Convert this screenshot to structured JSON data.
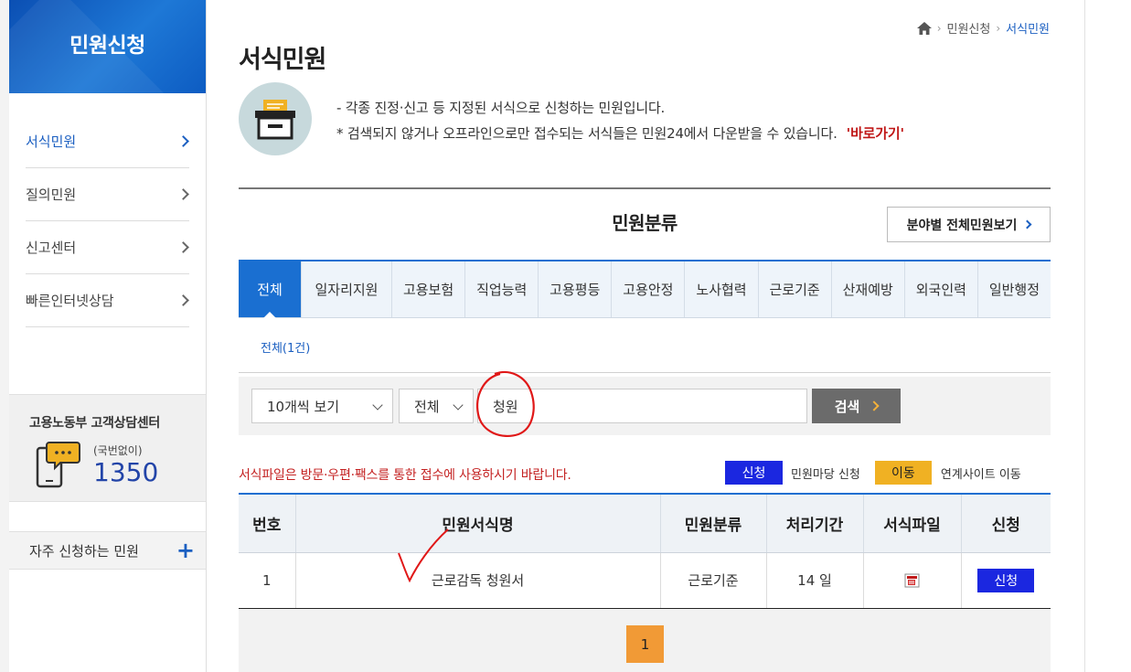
{
  "sidebar": {
    "title": "민원신청",
    "items": [
      {
        "label": "서식민원",
        "active": true
      },
      {
        "label": "질의민원",
        "active": false
      },
      {
        "label": "신고센터",
        "active": false
      },
      {
        "label": "빠른인터넷상담",
        "active": false
      }
    ],
    "cs_center": {
      "title": "고용노동부 고객상담센터",
      "sub": "(국번없이)",
      "number": "1350"
    },
    "favorite": {
      "label": "자주 신청하는 민원",
      "plus": "+"
    }
  },
  "breadcrumb": {
    "level1": "민원신청",
    "current": "서식민원"
  },
  "page_title": "서식민원",
  "intro": {
    "line1": "- 각종 진정·신고 등 지정된 서식으로 신청하는 민원입니다.",
    "line2": "* 검색되지 않거나 오프라인으로만 접수되는 서식들은 민원24에서 다운받을 수 있습니다.",
    "link": "'바로가기'"
  },
  "category": {
    "title": "민원분류",
    "all_view_button": "분야별 전체민원보기",
    "tabs": [
      "전체",
      "일자리지원",
      "고용보험",
      "직업능력",
      "고용평등",
      "고용안정",
      "노사협력",
      "근로기준",
      "산재예방",
      "외국인력",
      "일반행정"
    ],
    "count_label": "전체(1건)"
  },
  "search": {
    "page_size": "10개씩 보기",
    "scope": "전체",
    "query": "청원",
    "button": "검색"
  },
  "notice": "서식파일은 방문·우편·팩스를 통한 접수에 사용하시기 바랍니다.",
  "legend": {
    "apply_badge": "신청",
    "apply_desc": "민원마당 신청",
    "move_badge": "이동",
    "move_desc": "연계사이트 이동"
  },
  "table": {
    "headers": [
      "번호",
      "민원서식명",
      "민원분류",
      "처리기간",
      "서식파일",
      "신청"
    ],
    "rows": [
      {
        "no": "1",
        "name": "근로감독 청원서",
        "category": "근로기준",
        "period": "14 일",
        "apply": "신청"
      }
    ]
  },
  "pagination": {
    "current": "1"
  },
  "colors": {
    "primary_blue": "#1a6fd1",
    "apply_blue": "#1b27e0",
    "move_orange": "#f0b123",
    "notice_red": "#c42222",
    "page_orange": "#f19a36"
  }
}
